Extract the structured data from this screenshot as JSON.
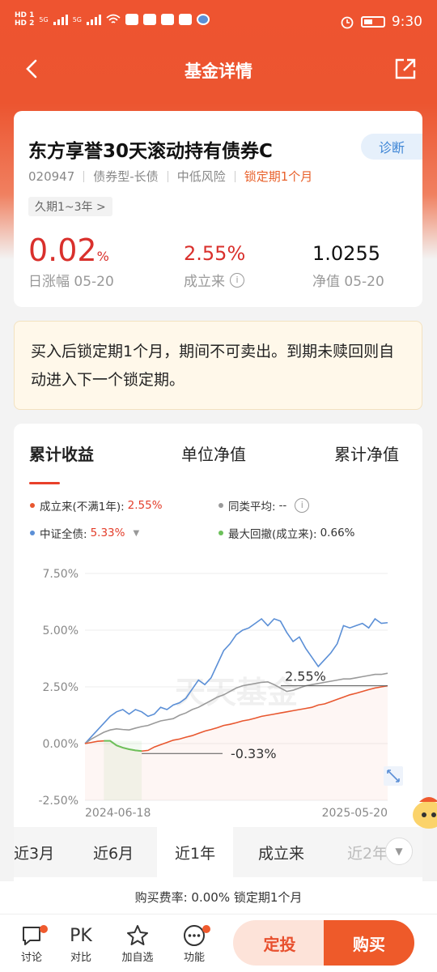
{
  "status": {
    "hd1": "HD 1",
    "hd2": "HD 2",
    "net1": "5G",
    "net2": "5G",
    "time": "9:30"
  },
  "nav": {
    "title": "基金详情"
  },
  "fund": {
    "name": "东方享誉30天滚动持有债券C",
    "diag_label": "诊断",
    "code": "020947",
    "type": "债券型-长债",
    "risk": "中低风险",
    "lock": "锁定期1个月",
    "duration_tag": "久期1~3年 >",
    "day_change_value": "0.02",
    "day_change_unit": "%",
    "day_change_label": "日涨幅 05-20",
    "since_value": "2.55%",
    "since_label": "成立来",
    "nav_value": "1.0255",
    "nav_label": "净值 05-20"
  },
  "notice": {
    "text": "买入后锁定期1个月，期间不可卖出。到期未赎回则自动进入下一个锁定期。"
  },
  "chart_tabs": [
    "累计收益",
    "单位净值",
    "累计净值"
  ],
  "legend": {
    "fund_label": "成立来(不满1年):",
    "fund_value": "2.55%",
    "peer_label": "同类平均:",
    "peer_value": "--",
    "index_label": "中证全债:",
    "index_value": "5.33%",
    "drawdown_label": "最大回撤(成立来):",
    "drawdown_value": "0.66%"
  },
  "colors": {
    "fund": "#e8572f",
    "peer": "#9a9a9a",
    "index": "#5b8fd6",
    "drawdown": "#6cc05a",
    "accent": "#ee5a2a"
  },
  "chart_data": {
    "type": "line",
    "x_start_label": "2024-06-18",
    "x_end_label": "2025-05-20",
    "y_ticks": [
      "7.50%",
      "5.00%",
      "2.50%",
      "0.00%",
      "-2.50%"
    ],
    "ylim": [
      -2.5,
      7.5
    ],
    "annotations": [
      "2.55%",
      "-0.33%"
    ],
    "watermark": "天天基金",
    "series": [
      {
        "name": "成立来",
        "values": [
          0.0,
          0.05,
          0.1,
          0.12,
          0.12,
          -0.08,
          -0.18,
          -0.25,
          -0.3,
          -0.33,
          -0.3,
          -0.15,
          -0.05,
          0.05,
          0.15,
          0.2,
          0.28,
          0.35,
          0.45,
          0.55,
          0.62,
          0.7,
          0.8,
          0.85,
          0.92,
          1.0,
          1.05,
          1.12,
          1.2,
          1.25,
          1.3,
          1.35,
          1.4,
          1.45,
          1.5,
          1.55,
          1.6,
          1.7,
          1.75,
          1.85,
          1.95,
          2.05,
          2.15,
          2.22,
          2.3,
          2.38,
          2.45,
          2.5,
          2.55
        ]
      },
      {
        "name": "同类平均",
        "values": [
          0.0,
          0.2,
          0.35,
          0.5,
          0.6,
          0.65,
          0.62,
          0.6,
          0.68,
          0.75,
          0.8,
          0.9,
          1.0,
          1.05,
          1.1,
          1.25,
          1.35,
          1.5,
          1.6,
          1.75,
          1.9,
          2.05,
          2.15,
          2.3,
          2.45,
          2.55,
          2.6,
          2.65,
          2.7,
          2.72,
          2.6,
          2.45,
          2.3,
          2.35,
          2.45,
          2.55,
          2.6,
          2.65,
          2.7,
          2.75,
          2.8,
          2.85,
          2.85,
          2.9,
          2.95,
          3.0,
          3.05,
          3.05,
          3.1
        ]
      },
      {
        "name": "中证全债",
        "values": [
          0.0,
          0.3,
          0.6,
          0.9,
          1.2,
          1.4,
          1.5,
          1.3,
          1.5,
          1.4,
          1.2,
          1.3,
          1.6,
          1.5,
          1.7,
          1.8,
          2.0,
          2.4,
          2.8,
          2.6,
          2.9,
          3.5,
          4.1,
          4.4,
          4.8,
          5.0,
          5.1,
          5.3,
          5.5,
          5.2,
          5.5,
          5.4,
          4.9,
          4.5,
          4.7,
          4.2,
          3.8,
          3.4,
          3.7,
          4.0,
          4.4,
          5.2,
          5.1,
          5.2,
          5.3,
          5.1,
          5.5,
          5.3,
          5.33
        ]
      }
    ]
  },
  "periods": [
    "近3月",
    "近6月",
    "近1年",
    "成立来",
    "近2年"
  ],
  "active_period": 2,
  "fee": {
    "text": "购买费率: 0.00%  锁定期1个月"
  },
  "bottom": {
    "items": [
      "讨论",
      "对比",
      "加自选",
      "功能"
    ],
    "pk": "PK",
    "fix_label": "定投",
    "buy_label": "购买"
  }
}
